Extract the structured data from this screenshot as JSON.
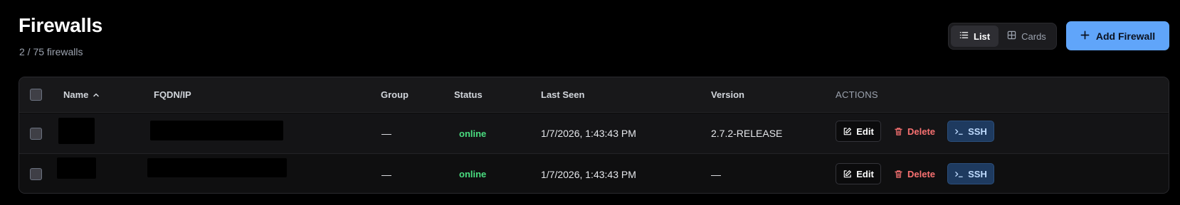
{
  "header": {
    "title": "Firewalls",
    "subtitle": "2 / 75 firewalls"
  },
  "view_toggle": {
    "list_label": "List",
    "cards_label": "Cards",
    "active": "List"
  },
  "add_button": {
    "label": "Add Firewall"
  },
  "table": {
    "columns": {
      "name": "Name",
      "fqdn": "FQDN/IP",
      "group": "Group",
      "status": "Status",
      "last_seen": "Last Seen",
      "version": "Version",
      "actions": "ACTIONS"
    },
    "sort": {
      "column": "Name",
      "direction": "ascending"
    },
    "rows": [
      {
        "name": "",
        "fqdn": "",
        "group": "—",
        "status": "online",
        "last_seen": "1/7/2026, 1:43:43 PM",
        "version": "2.7.2-RELEASE"
      },
      {
        "name": "",
        "fqdn": "",
        "group": "—",
        "status": "online",
        "last_seen": "1/7/2026, 1:43:43 PM",
        "version": "—"
      }
    ],
    "actions": {
      "edit_label": "Edit",
      "delete_label": "Delete",
      "ssh_label": "SSH"
    }
  },
  "colors": {
    "background": "#000000",
    "accent": "#60a5fa",
    "online": "#4ade80",
    "danger": "#f87171",
    "ssh_bg": "#1e3a5f"
  }
}
